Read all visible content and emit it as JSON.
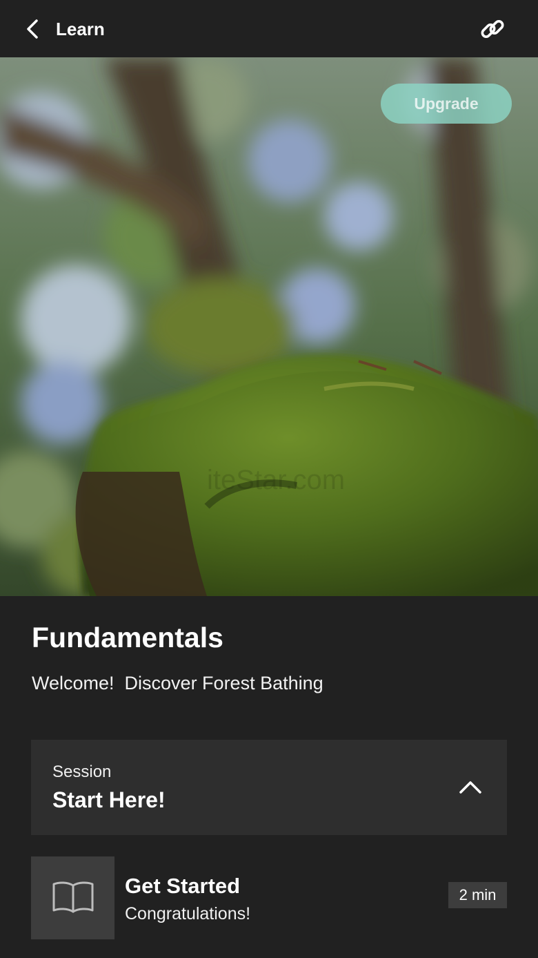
{
  "header": {
    "title": "Learn",
    "back_icon": "chevron-left-icon",
    "share_icon": "link-icon"
  },
  "hero": {
    "upgrade_label": "Upgrade",
    "accent_color": "#8cd4c4"
  },
  "course": {
    "title": "Fundamentals",
    "subtitle": "Welcome!  Discover Forest Bathing"
  },
  "session": {
    "label": "Session",
    "name": "Start Here!",
    "toggle_icon": "chevron-up-icon"
  },
  "lessons": [
    {
      "title": "Get Started",
      "subtitle": "Congratulations!",
      "duration": "2 min",
      "icon": "book-icon"
    }
  ]
}
